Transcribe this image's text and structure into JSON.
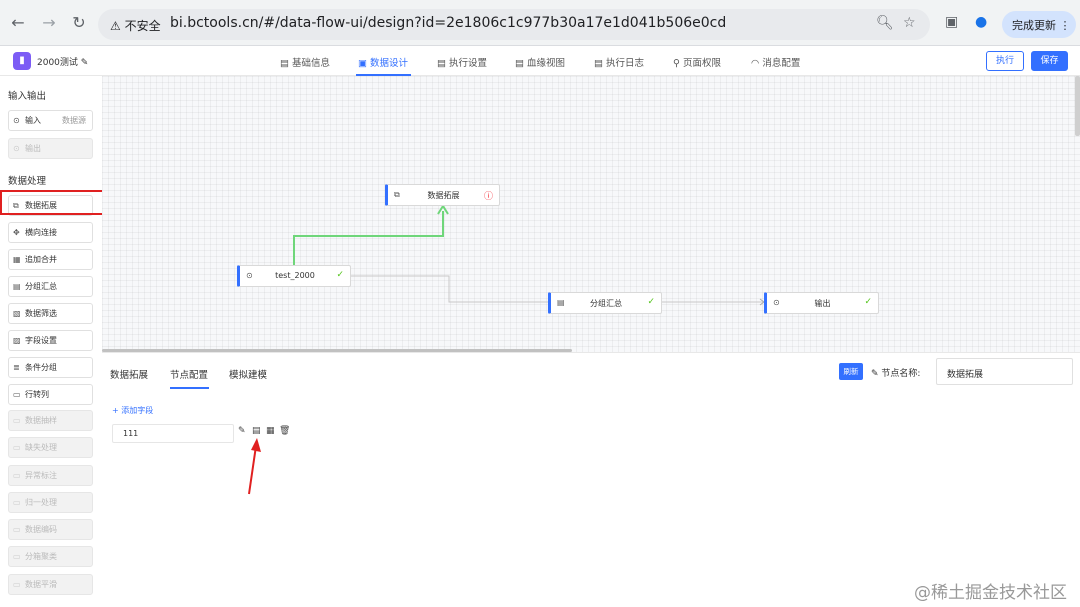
{
  "browser": {
    "back": "←",
    "forward": "→",
    "reload": "↻",
    "security": "不安全",
    "url": "bi.bctools.cn/#/data-flow-ui/design?id=2e1806c1c977b30a17e1d041b506e0cd",
    "update_button": "完成更新"
  },
  "header": {
    "project_name": "2000测试",
    "tabs": [
      "基础信息",
      "数据设计",
      "执行设置",
      "血缘视图",
      "执行日志",
      "页面权限",
      "消息配置"
    ],
    "active_tab": "数据设计",
    "execute_label": "执行",
    "save_label": "保存"
  },
  "sidebar": {
    "section_io": "输入输出",
    "input_label": "输入",
    "input_extra": "数据源",
    "output_label": "输出",
    "section_process": "数据处理",
    "items": [
      "数据拓展",
      "横向连接",
      "追加合并",
      "分组汇总",
      "数据筛选",
      "字段设置",
      "条件分组",
      "行转列"
    ],
    "disabled_items": [
      "数据抽样",
      "缺失处理",
      "异常标注",
      "归一处理",
      "数据编码",
      "分箱聚类",
      "数据平滑"
    ]
  },
  "canvas": {
    "nodes": [
      {
        "label": "数据拓展",
        "status": "error"
      },
      {
        "label": "test_2000",
        "status": "ok"
      },
      {
        "label": "分组汇总",
        "status": "ok"
      },
      {
        "label": "输出",
        "status": "ok"
      }
    ]
  },
  "panel": {
    "tabs": [
      "数据拓展",
      "节点配置",
      "模拟建模"
    ],
    "active_tab": "节点配置",
    "refresh_label": "刷新",
    "node_name_label": "节点名称:",
    "node_name_value": "数据拓展",
    "add_field_label": "+ 添加字段",
    "field_value": "111"
  },
  "colors": {
    "primary": "#3370ff",
    "success": "#52c41a",
    "error": "#f5222d",
    "highlight_box": "#e02020"
  },
  "watermark": "@稀土掘金技术社区"
}
